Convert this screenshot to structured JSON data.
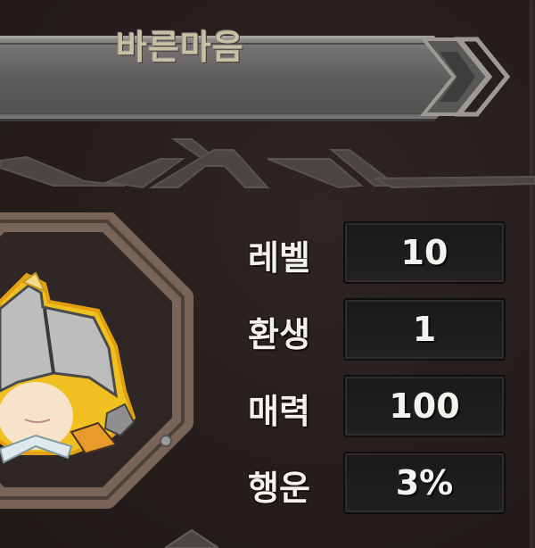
{
  "character": {
    "name": "바른마음"
  },
  "stats": [
    {
      "label": "레벨",
      "value": "10"
    },
    {
      "label": "환생",
      "value": "1"
    },
    {
      "label": "매력",
      "value": "100"
    },
    {
      "label": "행운",
      "value": "3%"
    }
  ],
  "colors": {
    "background": "#2a2220",
    "banner": "#6b6967",
    "title_text": "#c6c0a4",
    "medallion_wood": "#7a6458",
    "avatar_outline": "#f0c020"
  },
  "icons": {
    "chevron": "double-chevron-right-icon",
    "avatar": "character-portrait"
  }
}
